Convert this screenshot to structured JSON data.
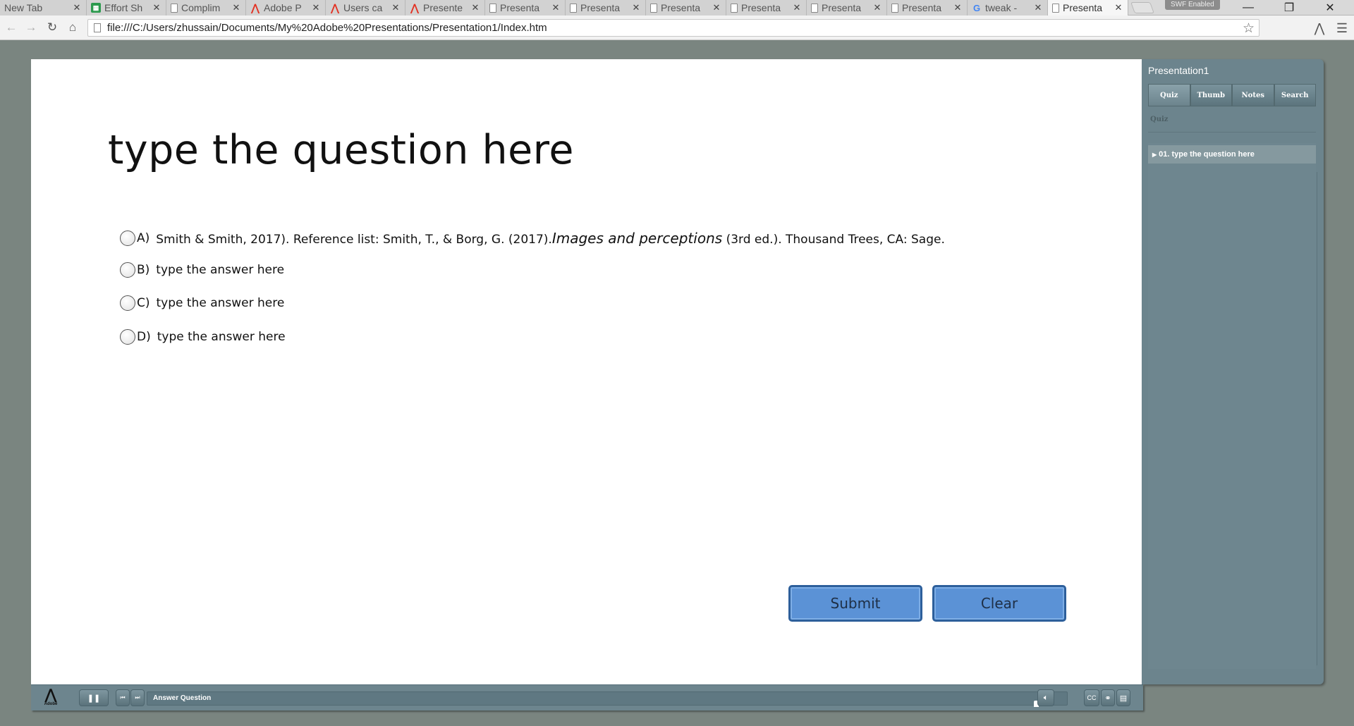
{
  "browser": {
    "tabs": [
      {
        "label": "New Tab",
        "icon": "blank-icon"
      },
      {
        "label": "Effort Sh",
        "icon": "sheets-icon"
      },
      {
        "label": "Complim",
        "icon": "page-icon"
      },
      {
        "label": "Adobe P",
        "icon": "adobe-icon"
      },
      {
        "label": "Users ca",
        "icon": "adobe-icon"
      },
      {
        "label": "Presente",
        "icon": "adobe-icon"
      },
      {
        "label": "Presenta",
        "icon": "page-icon"
      },
      {
        "label": "Presenta",
        "icon": "page-icon"
      },
      {
        "label": "Presenta",
        "icon": "page-icon"
      },
      {
        "label": "Presenta",
        "icon": "page-icon"
      },
      {
        "label": "Presenta",
        "icon": "page-icon"
      },
      {
        "label": "Presenta",
        "icon": "page-icon"
      },
      {
        "label": "tweak - ",
        "icon": "google-icon"
      },
      {
        "label": "Presenta",
        "icon": "page-icon",
        "active": true
      }
    ],
    "swf_badge": "SWF Enabled",
    "url": "file:///C:/Users/zhussain/Documents/My%20Adobe%20Presentations/Presentation1/Index.htm"
  },
  "slide": {
    "question": "type the question here",
    "answers": [
      {
        "letter": "A)",
        "text_before": "Smith & Smith, 2017). Reference list: Smith, T., & Borg, G. (2017).",
        "text_italic": "Images and perceptions",
        "text_after": " (3rd ed.). Thousand Trees, CA: Sage."
      },
      {
        "letter": "B)",
        "text": "type the answer here"
      },
      {
        "letter": "C)",
        "text": "type the answer here"
      },
      {
        "letter": "D)",
        "text": "type the answer here"
      }
    ],
    "submit_label": "Submit",
    "clear_label": "Clear"
  },
  "playbar": {
    "logo_text": "Adobe",
    "status": "Answer Question",
    "cc_label": "CC"
  },
  "toc": {
    "title": "Presentation1",
    "tabs": [
      "Quiz",
      "Thumb",
      "Notes",
      "Search"
    ],
    "active_tab": "Quiz",
    "section_label": "Quiz",
    "items": [
      "01. type the question here"
    ]
  },
  "colors": {
    "button_fill": "#5b92d6",
    "button_border": "#2d5f9b",
    "panel": "#6c848d",
    "page_bg": "#7a8580"
  }
}
